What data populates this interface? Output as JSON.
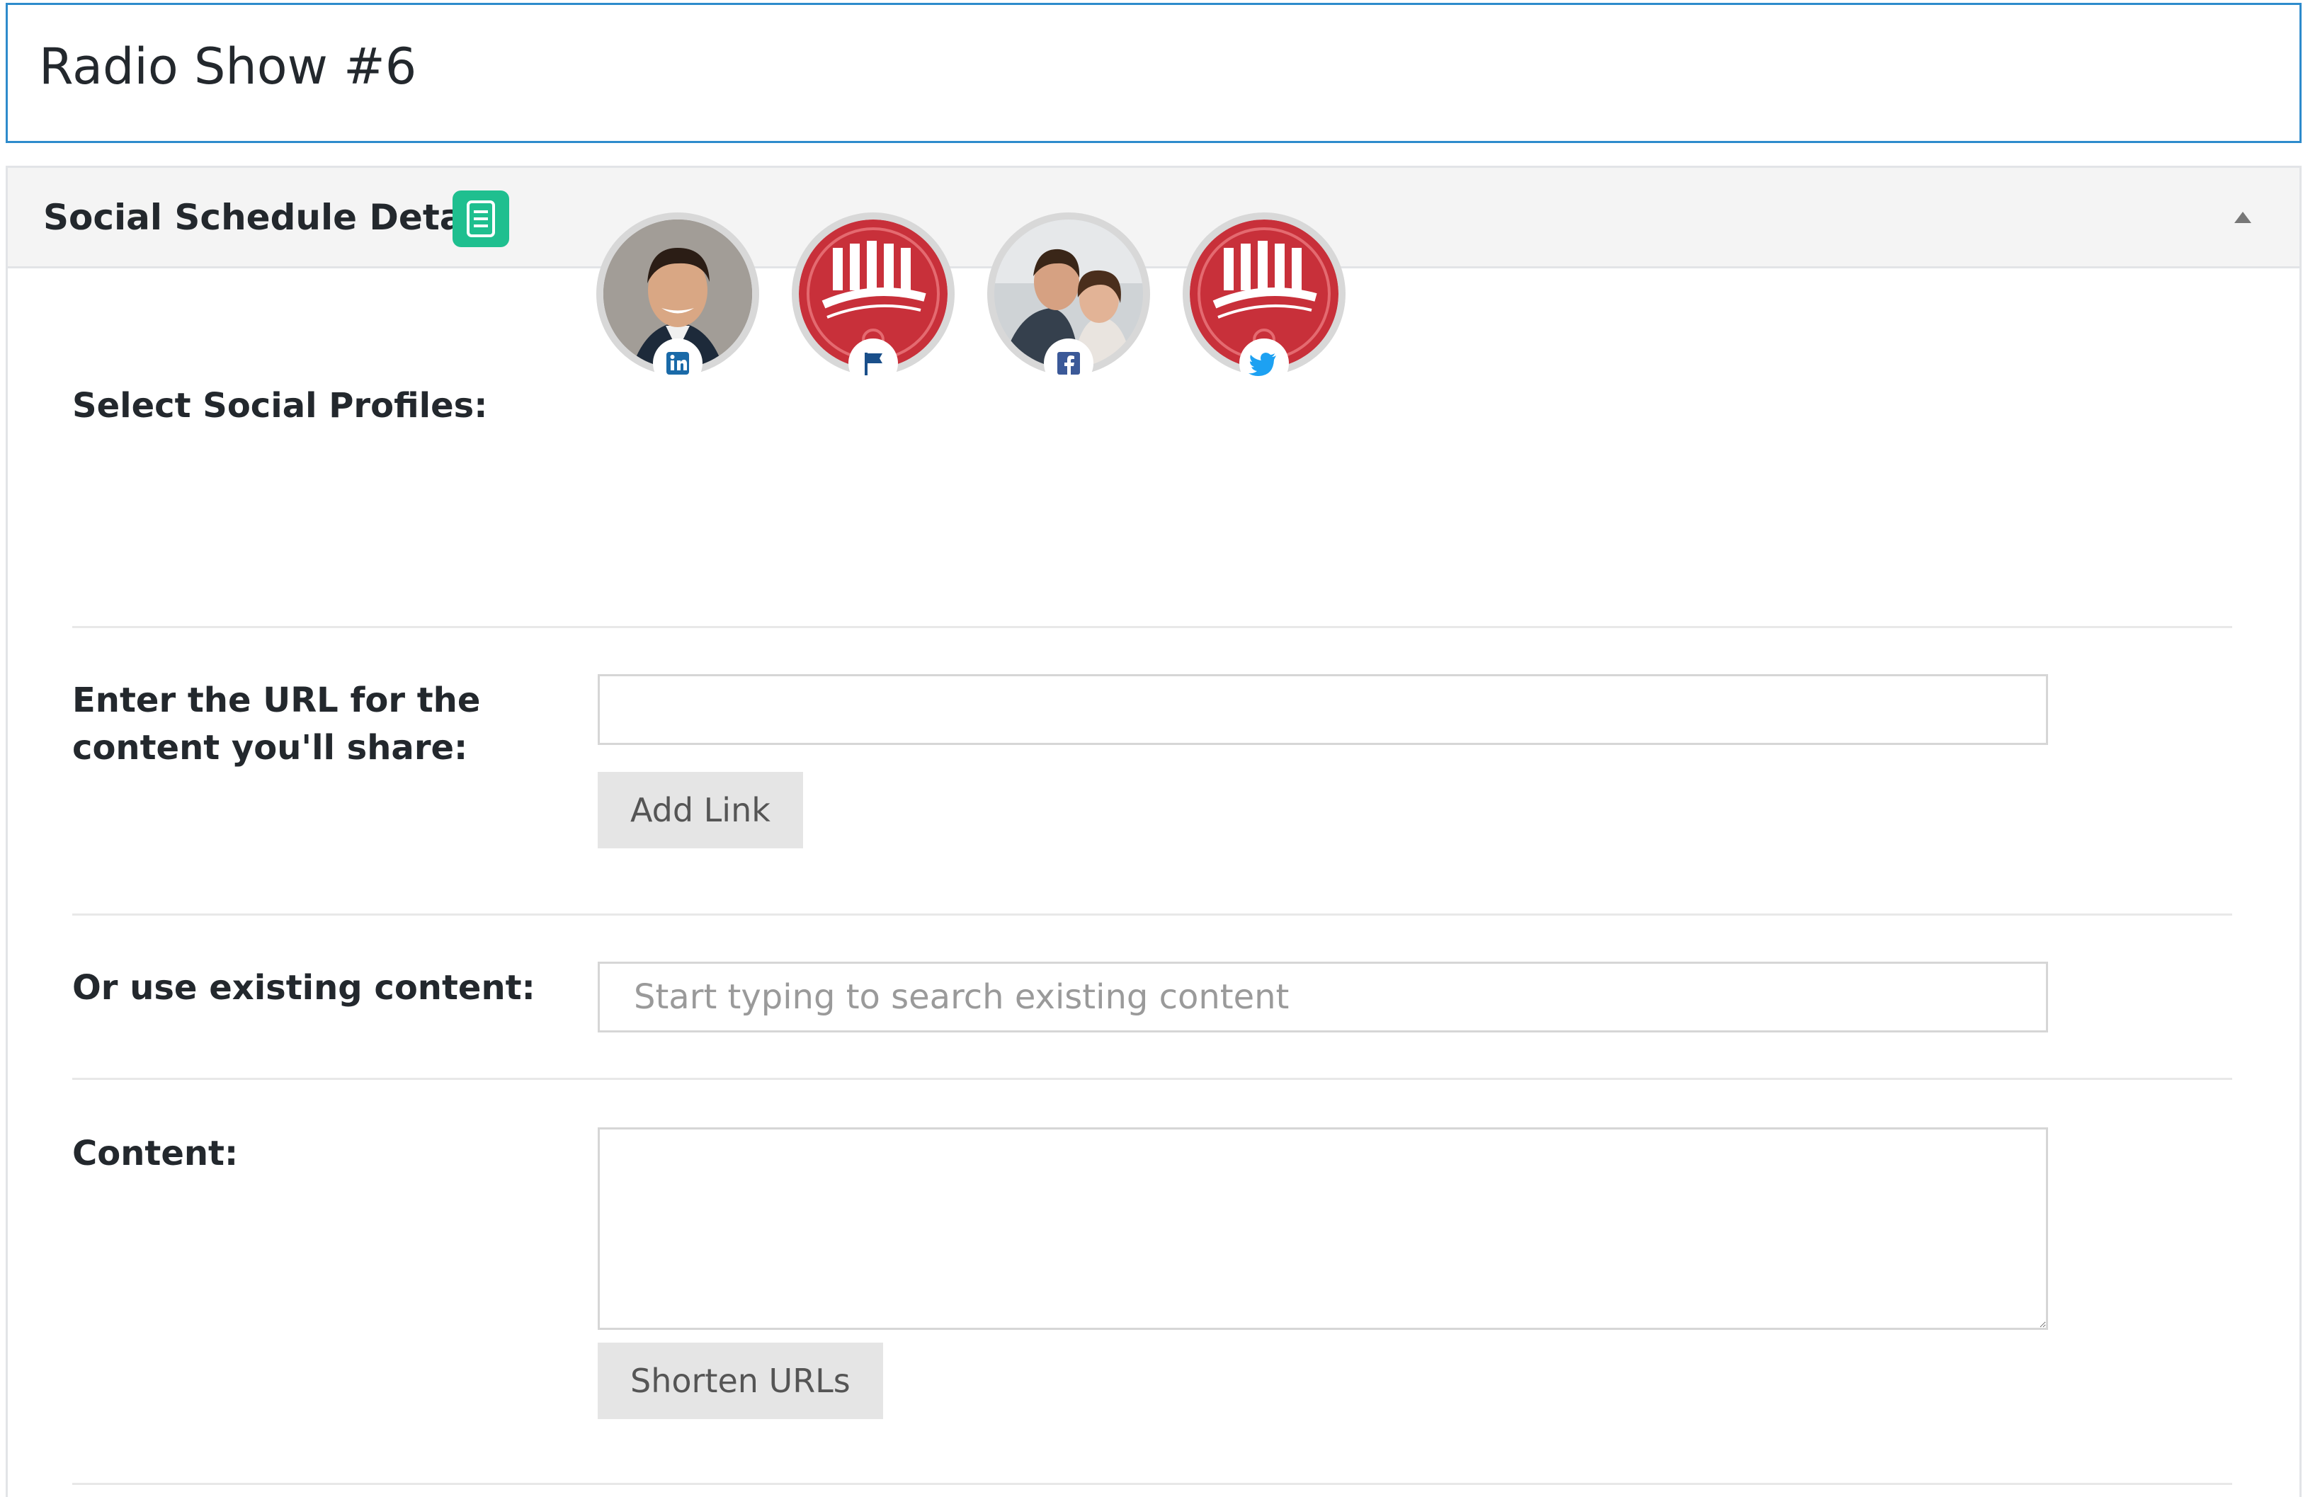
{
  "post": {
    "title": "Radio Show #6"
  },
  "panel": {
    "title": "Social Schedule Details",
    "header_icon": "document-icon",
    "collapse_icon": "triangle-up-icon",
    "accent_color": "#1fbf8f"
  },
  "profiles": {
    "label": "Select Social Profiles:",
    "items": [
      {
        "network": "linkedin",
        "avatar": "man-portrait"
      },
      {
        "network": "page",
        "avatar": "assembly-call-logo"
      },
      {
        "network": "facebook",
        "avatar": "couple-portrait"
      },
      {
        "network": "twitter",
        "avatar": "assembly-call-logo"
      }
    ]
  },
  "url_field": {
    "label": "Enter the URL for the content you'll share:",
    "value": "",
    "button_label": "Add Link"
  },
  "existing_content": {
    "label": "Or use existing content:",
    "placeholder": "Start typing to search existing content"
  },
  "content_field": {
    "label": "Content:",
    "value": "",
    "button_label": "Shorten URLs"
  }
}
